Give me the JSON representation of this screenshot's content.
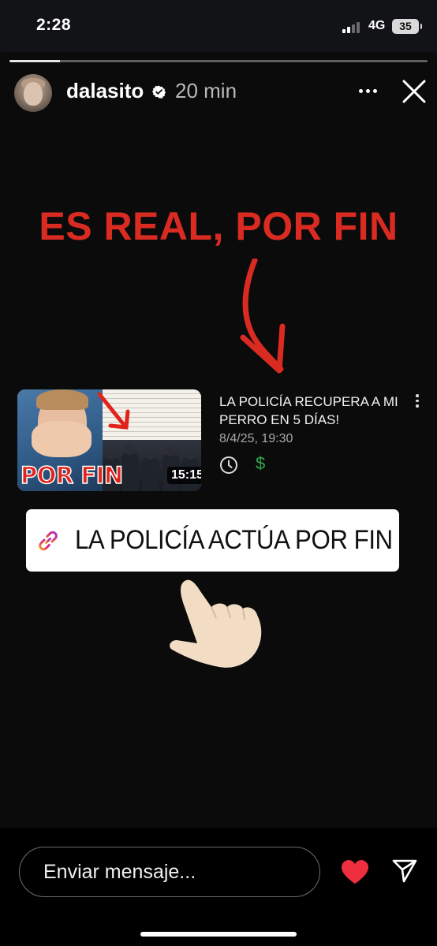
{
  "status_bar": {
    "time": "2:28",
    "network": "4G",
    "battery": "35"
  },
  "story": {
    "progress": 0.12,
    "username": "dalasito",
    "verified": true,
    "time_ago": "20 min",
    "headline": "ES REAL, POR FIN",
    "video": {
      "title": "LA POLICÍA RECUPERA A MI PERRO EN 5 DÍAS!",
      "date": "8/4/25, 19:30",
      "duration": "15:15",
      "thumbnail_text": "POR FIN",
      "dollar_symbol": "$"
    },
    "link_sticker": {
      "label": "LA POLICÍA ACTÚA POR FIN"
    },
    "icons": [
      "more-icon",
      "close-icon",
      "clock-icon",
      "dollar-icon",
      "link-icon",
      "pointing-hand-icon"
    ]
  },
  "bottom_bar": {
    "message_placeholder": "Enviar mensaje...",
    "like_color": "#ed2f3f"
  },
  "colors": {
    "headline": "#d92b22",
    "background": "#0b0b0b"
  }
}
